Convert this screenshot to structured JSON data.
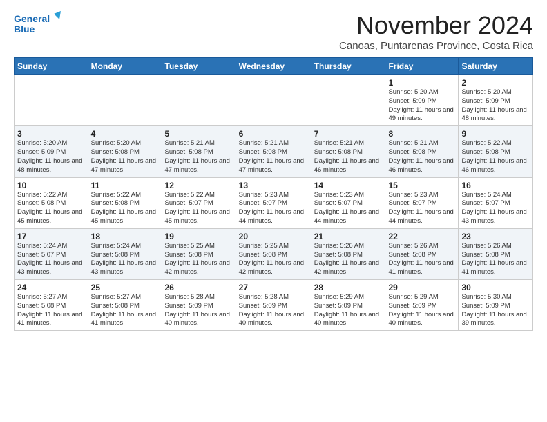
{
  "logo": {
    "line1": "General",
    "line2": "Blue"
  },
  "header": {
    "month": "November 2024",
    "location": "Canoas, Puntarenas Province, Costa Rica"
  },
  "weekdays": [
    "Sunday",
    "Monday",
    "Tuesday",
    "Wednesday",
    "Thursday",
    "Friday",
    "Saturday"
  ],
  "weeks": [
    [
      {
        "day": "",
        "info": ""
      },
      {
        "day": "",
        "info": ""
      },
      {
        "day": "",
        "info": ""
      },
      {
        "day": "",
        "info": ""
      },
      {
        "day": "",
        "info": ""
      },
      {
        "day": "1",
        "info": "Sunrise: 5:20 AM\nSunset: 5:09 PM\nDaylight: 11 hours and 49 minutes."
      },
      {
        "day": "2",
        "info": "Sunrise: 5:20 AM\nSunset: 5:09 PM\nDaylight: 11 hours and 48 minutes."
      }
    ],
    [
      {
        "day": "3",
        "info": "Sunrise: 5:20 AM\nSunset: 5:09 PM\nDaylight: 11 hours and 48 minutes."
      },
      {
        "day": "4",
        "info": "Sunrise: 5:20 AM\nSunset: 5:08 PM\nDaylight: 11 hours and 47 minutes."
      },
      {
        "day": "5",
        "info": "Sunrise: 5:21 AM\nSunset: 5:08 PM\nDaylight: 11 hours and 47 minutes."
      },
      {
        "day": "6",
        "info": "Sunrise: 5:21 AM\nSunset: 5:08 PM\nDaylight: 11 hours and 47 minutes."
      },
      {
        "day": "7",
        "info": "Sunrise: 5:21 AM\nSunset: 5:08 PM\nDaylight: 11 hours and 46 minutes."
      },
      {
        "day": "8",
        "info": "Sunrise: 5:21 AM\nSunset: 5:08 PM\nDaylight: 11 hours and 46 minutes."
      },
      {
        "day": "9",
        "info": "Sunrise: 5:22 AM\nSunset: 5:08 PM\nDaylight: 11 hours and 46 minutes."
      }
    ],
    [
      {
        "day": "10",
        "info": "Sunrise: 5:22 AM\nSunset: 5:08 PM\nDaylight: 11 hours and 45 minutes."
      },
      {
        "day": "11",
        "info": "Sunrise: 5:22 AM\nSunset: 5:08 PM\nDaylight: 11 hours and 45 minutes."
      },
      {
        "day": "12",
        "info": "Sunrise: 5:22 AM\nSunset: 5:07 PM\nDaylight: 11 hours and 45 minutes."
      },
      {
        "day": "13",
        "info": "Sunrise: 5:23 AM\nSunset: 5:07 PM\nDaylight: 11 hours and 44 minutes."
      },
      {
        "day": "14",
        "info": "Sunrise: 5:23 AM\nSunset: 5:07 PM\nDaylight: 11 hours and 44 minutes."
      },
      {
        "day": "15",
        "info": "Sunrise: 5:23 AM\nSunset: 5:07 PM\nDaylight: 11 hours and 44 minutes."
      },
      {
        "day": "16",
        "info": "Sunrise: 5:24 AM\nSunset: 5:07 PM\nDaylight: 11 hours and 43 minutes."
      }
    ],
    [
      {
        "day": "17",
        "info": "Sunrise: 5:24 AM\nSunset: 5:07 PM\nDaylight: 11 hours and 43 minutes."
      },
      {
        "day": "18",
        "info": "Sunrise: 5:24 AM\nSunset: 5:08 PM\nDaylight: 11 hours and 43 minutes."
      },
      {
        "day": "19",
        "info": "Sunrise: 5:25 AM\nSunset: 5:08 PM\nDaylight: 11 hours and 42 minutes."
      },
      {
        "day": "20",
        "info": "Sunrise: 5:25 AM\nSunset: 5:08 PM\nDaylight: 11 hours and 42 minutes."
      },
      {
        "day": "21",
        "info": "Sunrise: 5:26 AM\nSunset: 5:08 PM\nDaylight: 11 hours and 42 minutes."
      },
      {
        "day": "22",
        "info": "Sunrise: 5:26 AM\nSunset: 5:08 PM\nDaylight: 11 hours and 41 minutes."
      },
      {
        "day": "23",
        "info": "Sunrise: 5:26 AM\nSunset: 5:08 PM\nDaylight: 11 hours and 41 minutes."
      }
    ],
    [
      {
        "day": "24",
        "info": "Sunrise: 5:27 AM\nSunset: 5:08 PM\nDaylight: 11 hours and 41 minutes."
      },
      {
        "day": "25",
        "info": "Sunrise: 5:27 AM\nSunset: 5:08 PM\nDaylight: 11 hours and 41 minutes."
      },
      {
        "day": "26",
        "info": "Sunrise: 5:28 AM\nSunset: 5:09 PM\nDaylight: 11 hours and 40 minutes."
      },
      {
        "day": "27",
        "info": "Sunrise: 5:28 AM\nSunset: 5:09 PM\nDaylight: 11 hours and 40 minutes."
      },
      {
        "day": "28",
        "info": "Sunrise: 5:29 AM\nSunset: 5:09 PM\nDaylight: 11 hours and 40 minutes."
      },
      {
        "day": "29",
        "info": "Sunrise: 5:29 AM\nSunset: 5:09 PM\nDaylight: 11 hours and 40 minutes."
      },
      {
        "day": "30",
        "info": "Sunrise: 5:30 AM\nSunset: 5:09 PM\nDaylight: 11 hours and 39 minutes."
      }
    ]
  ]
}
